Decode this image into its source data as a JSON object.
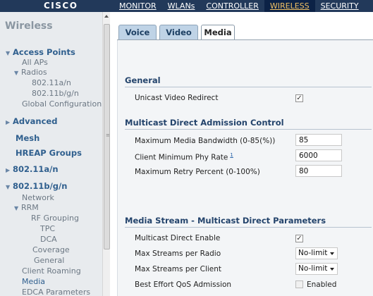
{
  "brand": "CISCO",
  "top_nav": {
    "items": [
      "MONITOR",
      "WLANs",
      "CONTROLLER",
      "WIRELESS",
      "SECURITY"
    ],
    "active": "WIRELESS"
  },
  "sidebar": {
    "title": "Wireless",
    "items": [
      {
        "label": "Access Points",
        "level": 0,
        "expanded": true
      },
      {
        "label": "All APs",
        "level": 1
      },
      {
        "label": "Radios",
        "level": 1,
        "expanded": true
      },
      {
        "label": "802.11a/n",
        "level": 2
      },
      {
        "label": "802.11b/g/n",
        "level": 2
      },
      {
        "label": "Global Configuration",
        "level": 1
      },
      {
        "label": "Advanced",
        "level": 0,
        "expanded": false
      },
      {
        "label": "Mesh",
        "level": 0
      },
      {
        "label": "HREAP Groups",
        "level": 0
      },
      {
        "label": "802.11a/n",
        "level": 0,
        "expanded": false
      },
      {
        "label": "802.11b/g/n",
        "level": 0,
        "expanded": true
      },
      {
        "label": "Network",
        "level": 1
      },
      {
        "label": "RRM",
        "level": 1,
        "expanded": true
      },
      {
        "label": "RF Grouping",
        "level": 2
      },
      {
        "label": "TPC",
        "level": 2
      },
      {
        "label": "DCA",
        "level": 2
      },
      {
        "label": "Coverage",
        "level": 2
      },
      {
        "label": "General",
        "level": 2
      },
      {
        "label": "Client Roaming",
        "level": 1
      },
      {
        "label": "Media",
        "level": 1,
        "selected": true
      },
      {
        "label": "EDCA Parameters",
        "level": 1
      }
    ]
  },
  "tabs": [
    {
      "label": "Voice",
      "active": false
    },
    {
      "label": "Video",
      "active": false
    },
    {
      "label": "Media",
      "active": true
    }
  ],
  "general": {
    "heading": "General",
    "unicast_video_redirect": {
      "label": "Unicast Video Redirect",
      "checked": true
    }
  },
  "admission": {
    "heading": "Multicast Direct Admission Control",
    "max_media_bandwidth": {
      "label": "Maximum Media Bandwidth (0-85(%))",
      "value": "85"
    },
    "client_min_phy_rate": {
      "label": "Client Minimum Phy Rate",
      "footnote": "1",
      "value": "6000"
    },
    "max_retry_percent": {
      "label": "Maximum Retry Percent (0-100%)",
      "value": "80"
    }
  },
  "media_stream": {
    "heading": "Media Stream - Multicast Direct Parameters",
    "multicast_direct_enable": {
      "label": "Multicast Direct Enable",
      "checked": true
    },
    "max_streams_radio": {
      "label": "Max Streams per Radio",
      "value": "No-limit"
    },
    "max_streams_client": {
      "label": "Max Streams per Client",
      "value": "No-limit"
    },
    "best_effort_qos": {
      "label": "Best Effort QoS Admission",
      "option_label": "Enabled",
      "checked": false
    }
  },
  "colors": {
    "topbar": "#22395a",
    "active_nav_text": "#f2c264",
    "section_heading": "#24446c",
    "sidebar_bg": "#e8ebee",
    "tab_inactive": "#bfd3e6"
  }
}
